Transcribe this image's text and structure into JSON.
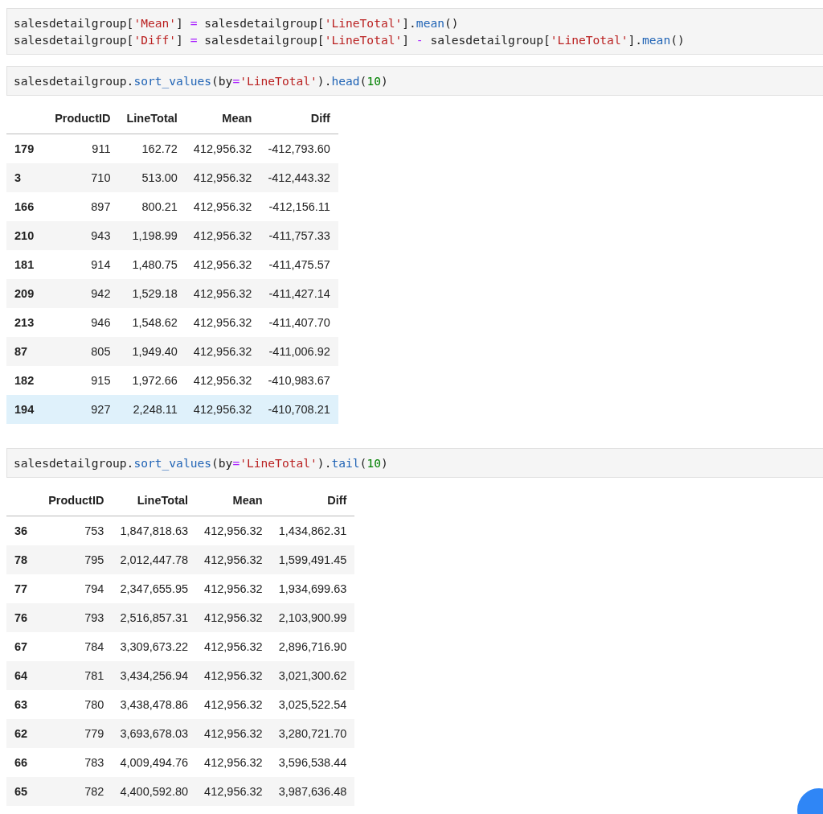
{
  "cells": [
    {
      "code": [
        [
          {
            "kind": "text",
            "text": "salesdetailgroup["
          },
          {
            "kind": "string",
            "text": "'Mean'"
          },
          {
            "kind": "text",
            "text": "] "
          },
          {
            "kind": "operator",
            "text": "="
          },
          {
            "kind": "text",
            "text": " salesdetailgroup["
          },
          {
            "kind": "string",
            "text": "'LineTotal'"
          },
          {
            "kind": "text",
            "text": "]."
          },
          {
            "kind": "function",
            "text": "mean"
          },
          {
            "kind": "text",
            "text": "()"
          }
        ],
        [
          {
            "kind": "text",
            "text": "salesdetailgroup["
          },
          {
            "kind": "string",
            "text": "'Diff'"
          },
          {
            "kind": "text",
            "text": "] "
          },
          {
            "kind": "operator",
            "text": "="
          },
          {
            "kind": "text",
            "text": " salesdetailgroup["
          },
          {
            "kind": "string",
            "text": "'LineTotal'"
          },
          {
            "kind": "text",
            "text": "] "
          },
          {
            "kind": "operator",
            "text": "-"
          },
          {
            "kind": "text",
            "text": " salesdetailgroup["
          },
          {
            "kind": "string",
            "text": "'LineTotal'"
          },
          {
            "kind": "text",
            "text": "]."
          },
          {
            "kind": "function",
            "text": "mean"
          },
          {
            "kind": "text",
            "text": "()"
          }
        ]
      ]
    },
    {
      "code": [
        [
          {
            "kind": "text",
            "text": "salesdetailgroup."
          },
          {
            "kind": "function",
            "text": "sort_values"
          },
          {
            "kind": "text",
            "text": "(by"
          },
          {
            "kind": "operator",
            "text": "="
          },
          {
            "kind": "string",
            "text": "'LineTotal'"
          },
          {
            "kind": "text",
            "text": ")."
          },
          {
            "kind": "function",
            "text": "head"
          },
          {
            "kind": "text",
            "text": "("
          },
          {
            "kind": "number",
            "text": "10"
          },
          {
            "kind": "text",
            "text": ")"
          }
        ]
      ],
      "output": {
        "columns": [
          "ProductID",
          "LineTotal",
          "Mean",
          "Diff"
        ],
        "rows": [
          {
            "index": "179",
            "values": [
              "911",
              "162.72",
              "412,956.32",
              "-412,793.60"
            ],
            "selected": false
          },
          {
            "index": "3",
            "values": [
              "710",
              "513.00",
              "412,956.32",
              "-412,443.32"
            ],
            "selected": false
          },
          {
            "index": "166",
            "values": [
              "897",
              "800.21",
              "412,956.32",
              "-412,156.11"
            ],
            "selected": false
          },
          {
            "index": "210",
            "values": [
              "943",
              "1,198.99",
              "412,956.32",
              "-411,757.33"
            ],
            "selected": false
          },
          {
            "index": "181",
            "values": [
              "914",
              "1,480.75",
              "412,956.32",
              "-411,475.57"
            ],
            "selected": false
          },
          {
            "index": "209",
            "values": [
              "942",
              "1,529.18",
              "412,956.32",
              "-411,427.14"
            ],
            "selected": false
          },
          {
            "index": "213",
            "values": [
              "946",
              "1,548.62",
              "412,956.32",
              "-411,407.70"
            ],
            "selected": false
          },
          {
            "index": "87",
            "values": [
              "805",
              "1,949.40",
              "412,956.32",
              "-411,006.92"
            ],
            "selected": false
          },
          {
            "index": "182",
            "values": [
              "915",
              "1,972.66",
              "412,956.32",
              "-410,983.67"
            ],
            "selected": false
          },
          {
            "index": "194",
            "values": [
              "927",
              "2,248.11",
              "412,956.32",
              "-410,708.21"
            ],
            "selected": true
          }
        ]
      }
    },
    {
      "code": [
        [
          {
            "kind": "text",
            "text": "salesdetailgroup."
          },
          {
            "kind": "function",
            "text": "sort_values"
          },
          {
            "kind": "text",
            "text": "(by"
          },
          {
            "kind": "operator",
            "text": "="
          },
          {
            "kind": "string",
            "text": "'LineTotal'"
          },
          {
            "kind": "text",
            "text": ")."
          },
          {
            "kind": "function",
            "text": "tail"
          },
          {
            "kind": "text",
            "text": "("
          },
          {
            "kind": "number",
            "text": "10"
          },
          {
            "kind": "text",
            "text": ")"
          }
        ]
      ],
      "output": {
        "columns": [
          "ProductID",
          "LineTotal",
          "Mean",
          "Diff"
        ],
        "rows": [
          {
            "index": "36",
            "values": [
              "753",
              "1,847,818.63",
              "412,956.32",
              "1,434,862.31"
            ],
            "selected": false
          },
          {
            "index": "78",
            "values": [
              "795",
              "2,012,447.78",
              "412,956.32",
              "1,599,491.45"
            ],
            "selected": false
          },
          {
            "index": "77",
            "values": [
              "794",
              "2,347,655.95",
              "412,956.32",
              "1,934,699.63"
            ],
            "selected": false
          },
          {
            "index": "76",
            "values": [
              "793",
              "2,516,857.31",
              "412,956.32",
              "2,103,900.99"
            ],
            "selected": false
          },
          {
            "index": "67",
            "values": [
              "784",
              "3,309,673.22",
              "412,956.32",
              "2,896,716.90"
            ],
            "selected": false
          },
          {
            "index": "64",
            "values": [
              "781",
              "3,434,256.94",
              "412,956.32",
              "3,021,300.62"
            ],
            "selected": false
          },
          {
            "index": "63",
            "values": [
              "780",
              "3,438,478.86",
              "412,956.32",
              "3,025,522.54"
            ],
            "selected": false
          },
          {
            "index": "62",
            "values": [
              "779",
              "3,693,678.03",
              "412,956.32",
              "3,280,721.70"
            ],
            "selected": false
          },
          {
            "index": "66",
            "values": [
              "783",
              "4,009,494.76",
              "412,956.32",
              "3,596,538.44"
            ],
            "selected": false
          },
          {
            "index": "65",
            "values": [
              "782",
              "4,400,592.80",
              "412,956.32",
              "3,987,636.48"
            ],
            "selected": false
          }
        ]
      }
    }
  ]
}
